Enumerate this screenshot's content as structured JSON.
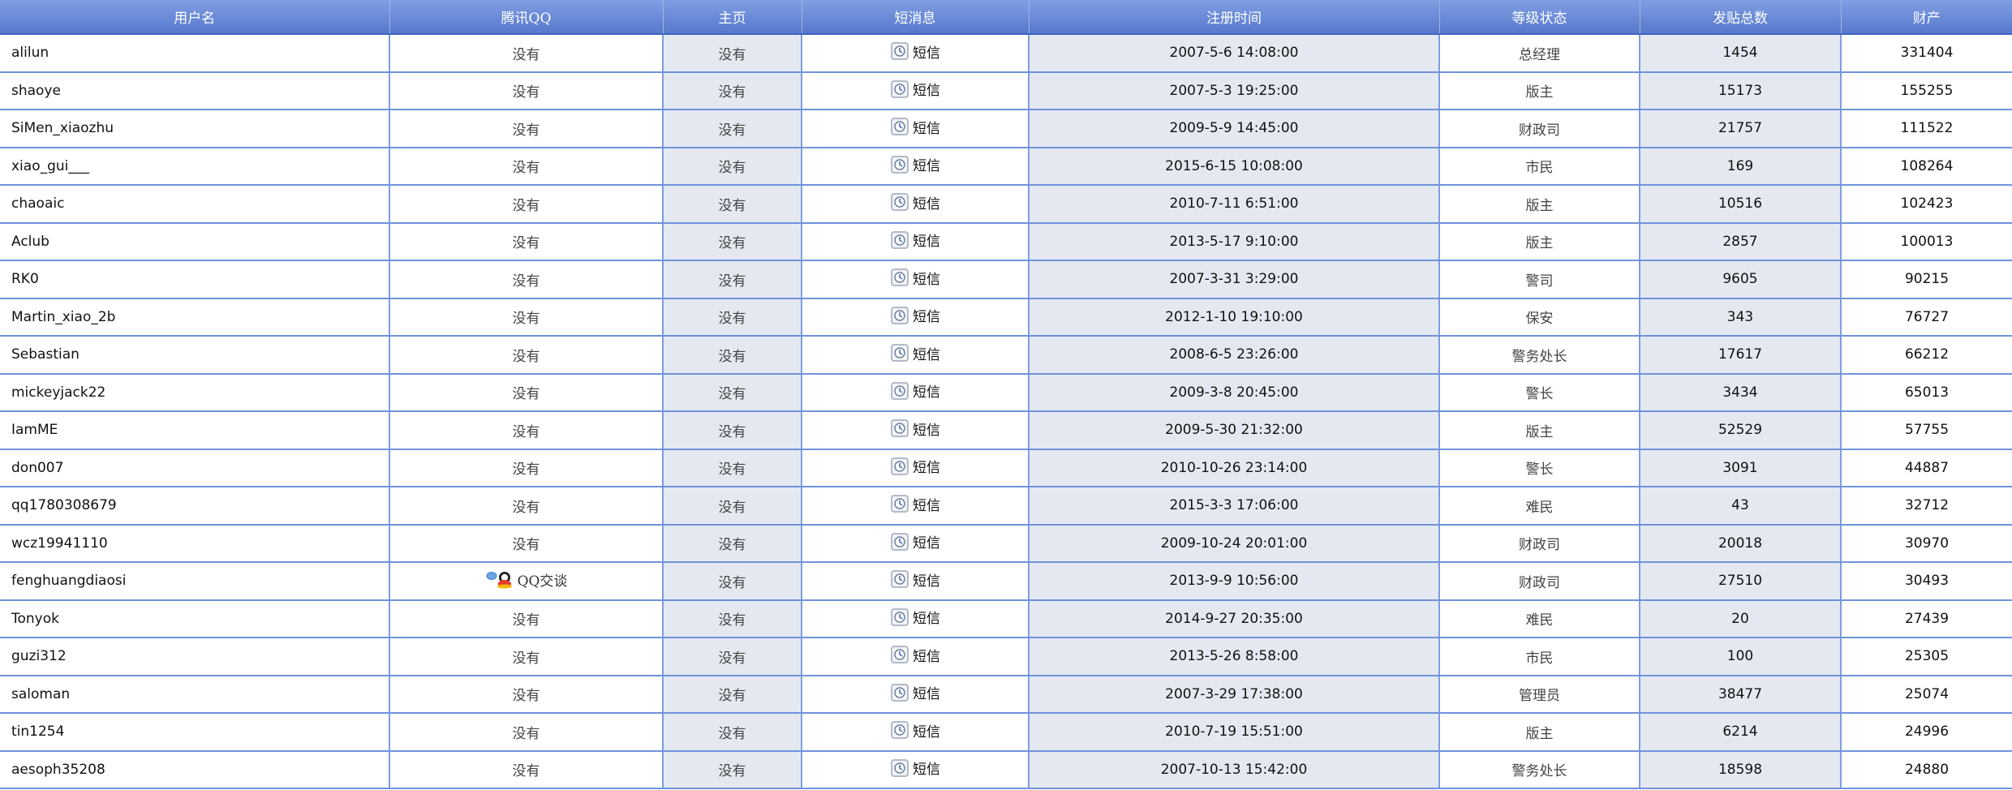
{
  "columns": [
    "用户名",
    "腾讯QQ",
    "主页",
    "短消息",
    "注册时间",
    "等级状态",
    "发贴总数",
    "财产"
  ],
  "sms_label": "短信",
  "none_label": "没有",
  "qq_chat_label": "QQ交谈",
  "colors": {
    "header_top": "#7f9ee3",
    "header_bottom": "#5678cb",
    "grid_line": "#6f92dc",
    "shaded_column": "#e4e9f1"
  },
  "rows": [
    {
      "username": "alilun",
      "qq": "没有",
      "homepage": "没有",
      "registered": "2007-5-6 14:08:00",
      "level": "总经理",
      "posts": "1454",
      "wealth": "331404"
    },
    {
      "username": "shaoye",
      "qq": "没有",
      "homepage": "没有",
      "registered": "2007-5-3 19:25:00",
      "level": "版主",
      "posts": "15173",
      "wealth": "155255"
    },
    {
      "username": "SiMen_xiaozhu",
      "qq": "没有",
      "homepage": "没有",
      "registered": "2009-5-9 14:45:00",
      "level": "财政司",
      "posts": "21757",
      "wealth": "111522"
    },
    {
      "username": "xiao_gui___",
      "qq": "没有",
      "homepage": "没有",
      "registered": "2015-6-15 10:08:00",
      "level": "市民",
      "posts": "169",
      "wealth": "108264"
    },
    {
      "username": "chaoaic",
      "qq": "没有",
      "homepage": "没有",
      "registered": "2010-7-11 6:51:00",
      "level": "版主",
      "posts": "10516",
      "wealth": "102423"
    },
    {
      "username": "Aclub",
      "qq": "没有",
      "homepage": "没有",
      "registered": "2013-5-17 9:10:00",
      "level": "版主",
      "posts": "2857",
      "wealth": "100013"
    },
    {
      "username": "RK0",
      "qq": "没有",
      "homepage": "没有",
      "registered": "2007-3-31 3:29:00",
      "level": "警司",
      "posts": "9605",
      "wealth": "90215"
    },
    {
      "username": "Martin_xiao_2b",
      "qq": "没有",
      "homepage": "没有",
      "registered": "2012-1-10 19:10:00",
      "level": "保安",
      "posts": "343",
      "wealth": "76727"
    },
    {
      "username": "Sebastian",
      "qq": "没有",
      "homepage": "没有",
      "registered": "2008-6-5 23:26:00",
      "level": "警务处长",
      "posts": "17617",
      "wealth": "66212"
    },
    {
      "username": "mickeyjack22",
      "qq": "没有",
      "homepage": "没有",
      "registered": "2009-3-8 20:45:00",
      "level": "警长",
      "posts": "3434",
      "wealth": "65013"
    },
    {
      "username": "IamME",
      "qq": "没有",
      "homepage": "没有",
      "registered": "2009-5-30 21:32:00",
      "level": "版主",
      "posts": "52529",
      "wealth": "57755"
    },
    {
      "username": "don007",
      "qq": "没有",
      "homepage": "没有",
      "registered": "2010-10-26 23:14:00",
      "level": "警长",
      "posts": "3091",
      "wealth": "44887"
    },
    {
      "username": "qq1780308679",
      "qq": "没有",
      "homepage": "没有",
      "registered": "2015-3-3 17:06:00",
      "level": "难民",
      "posts": "43",
      "wealth": "32712"
    },
    {
      "username": "wcz19941110",
      "qq": "没有",
      "homepage": "没有",
      "registered": "2009-10-24 20:01:00",
      "level": "财政司",
      "posts": "20018",
      "wealth": "30970"
    },
    {
      "username": "fenghuangdiaosi",
      "qq": "QQ交谈",
      "qq_is_chat": true,
      "homepage": "没有",
      "registered": "2013-9-9 10:56:00",
      "level": "财政司",
      "posts": "27510",
      "wealth": "30493"
    },
    {
      "username": "Tonyok",
      "qq": "没有",
      "homepage": "没有",
      "registered": "2014-9-27 20:35:00",
      "level": "难民",
      "posts": "20",
      "wealth": "27439"
    },
    {
      "username": "guzi312",
      "qq": "没有",
      "homepage": "没有",
      "registered": "2013-5-26 8:58:00",
      "level": "市民",
      "posts": "100",
      "wealth": "25305"
    },
    {
      "username": "saloman",
      "qq": "没有",
      "homepage": "没有",
      "registered": "2007-3-29 17:38:00",
      "level": "管理员",
      "posts": "38477",
      "wealth": "25074"
    },
    {
      "username": "tin1254",
      "qq": "没有",
      "homepage": "没有",
      "registered": "2010-7-19 15:51:00",
      "level": "版主",
      "posts": "6214",
      "wealth": "24996"
    },
    {
      "username": "aesoph35208",
      "qq": "没有",
      "homepage": "没有",
      "registered": "2007-10-13 15:42:00",
      "level": "警务处长",
      "posts": "18598",
      "wealth": "24880"
    }
  ]
}
